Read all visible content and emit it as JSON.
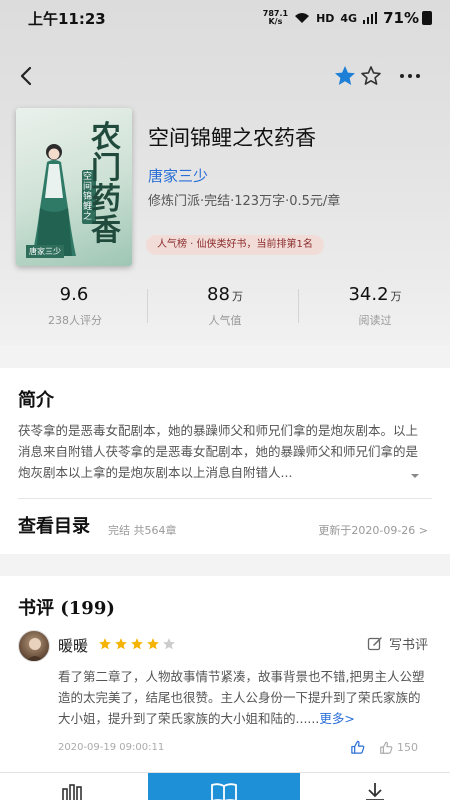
{
  "status_bar": {
    "time": "上午11:23",
    "speed_value": "787.1",
    "speed_unit": "K/s",
    "hd": "HD",
    "network": "4G",
    "battery": "71%"
  },
  "nav": {
    "back_icon": "chevron-left-icon",
    "favorite_icon": "star-filled-icon",
    "rate_icon": "star-outline-icon",
    "more_icon": "more-dots-icon"
  },
  "book": {
    "cover_title": "农门药香",
    "cover_subtitle": "空间锦鲤之",
    "title": "空间锦鲤之农药香",
    "author": "唐家三少",
    "meta": "修炼门派·完结·123万字·0.5元/章",
    "rank_badge": "人气榜 · 仙侠类好书，当前排第1名"
  },
  "stats": [
    {
      "value": "9.6",
      "unit": "",
      "label": "238人评分"
    },
    {
      "value": "88",
      "unit": "万",
      "label": "人气值"
    },
    {
      "value": "34.2",
      "unit": "万",
      "label": "阅读过"
    }
  ],
  "intro": {
    "title": "简介",
    "text": "茯苓拿的是恶毒女配剧本，她的暴躁师父和师兄们拿的是炮灰剧本。以上消息来自附错人茯苓拿的是恶毒女配剧本，她的暴躁师父和师兄们拿的是炮灰剧本以上拿的是炮灰剧本以上消息自附错人..."
  },
  "toc": {
    "title": "查看目录",
    "status": "完结 共564章",
    "updated": "更新于2020-09-26 >"
  },
  "reviews": {
    "title": "书评 (199)",
    "write_label": "写书评",
    "items": [
      {
        "name": "暖暖",
        "rating": 4,
        "rating_max": 5,
        "text": "看了第二章了，人物故事情节紧凑，故事背景也不错,把男主人公塑造的太完美了，结尾也很赞。主人公身份一下提升到了荣氏家族的大小姐，提升到了荣氏家族的大小姐和陆的......",
        "more": "更多>",
        "date": "2020-09-19 09:00:11",
        "likes": "150"
      }
    ]
  },
  "colors": {
    "accent": "#1e90d8",
    "link": "#2a6fd6",
    "star": "#f5b400",
    "badge_bg": "#f2dcd8"
  }
}
